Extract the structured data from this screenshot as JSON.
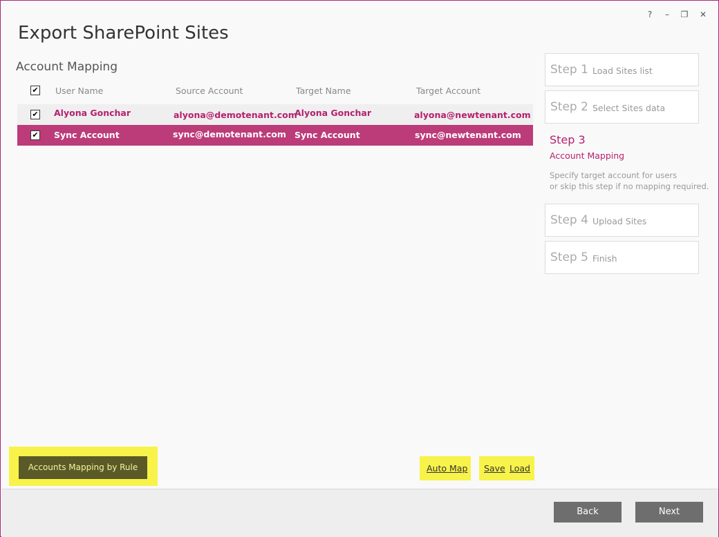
{
  "window": {
    "help_label": "?",
    "minimize_label": "–",
    "restore_label": "❐",
    "close_label": "✕"
  },
  "app_title": "Export SharePoint Sites",
  "section_title": "Account Mapping",
  "table": {
    "headers": [
      "User Name",
      "Source Account",
      "Target Name",
      "Target Account"
    ],
    "select_all_checked": true,
    "rows": [
      {
        "user_name": "Alyona Gonchar",
        "source_account": "alyona@demotenant.com",
        "target_name": "Alyona Gonchar",
        "target_account": "alyona@newtenant.com",
        "checked": true,
        "selected": false
      },
      {
        "user_name": "Sync Account",
        "source_account": "sync@demotenant.com",
        "target_name": "Sync Account",
        "target_account": "sync@newtenant.com",
        "checked": true,
        "selected": true
      }
    ]
  },
  "steps": [
    {
      "num": "Step 1",
      "label": "Load Sites list"
    },
    {
      "num": "Step 2",
      "label": "Select Sites data"
    },
    {
      "num": "Step 3",
      "label": "Account Mapping",
      "description_line1": "Specify target account for users",
      "description_line2": "or skip this step if no mapping required."
    },
    {
      "num": "Step 4",
      "label": "Upload Sites"
    },
    {
      "num": "Step 5",
      "label": "Finish"
    }
  ],
  "buttons": {
    "mapping_by_rule": "Accounts Mapping by Rule",
    "auto_map": "Auto Map",
    "save": "Save",
    "load": "Load",
    "back": "Back",
    "next": "Next"
  },
  "colors": {
    "accent": "#b5206e",
    "selected_row": "#bc3b79",
    "highlight": "#f7f34a",
    "window_border": "#a8267a"
  }
}
